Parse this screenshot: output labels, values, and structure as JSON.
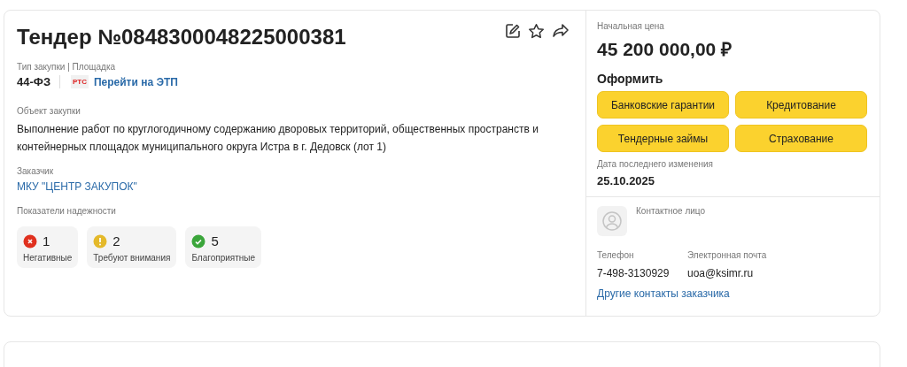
{
  "tender": {
    "title": "Тендер №0848300048225000381",
    "type_label": "Тип закупки | Площадка",
    "law": "44-ФЗ",
    "platform_logo": "РТС",
    "platform_link": "Перейти на ЭТП",
    "object_label": "Объект закупки",
    "object_text": "Выполнение работ по круглогодичному содержанию дворовых территорий, общественных пространств и контейнерных площадок муниципального округа Истра в г. Дедовск (лот 1)",
    "customer_label": "Заказчик",
    "customer": "МКУ \"ЦЕНТР ЗАКУПОК\"",
    "reliability_label": "Показатели надежности",
    "indicators": [
      {
        "kind": "negative",
        "count": "1",
        "label": "Негативные"
      },
      {
        "kind": "warning",
        "count": "2",
        "label": "Требуют внимания"
      },
      {
        "kind": "positive",
        "count": "5",
        "label": "Благоприятные"
      }
    ]
  },
  "price": {
    "label": "Начальная цена",
    "value": "45 200 000,00 ₽",
    "apply_label": "Оформить",
    "buttons": [
      "Банковские гарантии",
      "Кредитование",
      "Тендерные займы",
      "Страхование"
    ],
    "date_label": "Дата последнего изменения",
    "date": "25.10.2025"
  },
  "contact": {
    "person_label": "Контактное лицо",
    "phone_label": "Телефон",
    "phone": "7-498-3130929",
    "email_label": "Электронная почта",
    "email": "uoa@ksimr.ru",
    "other_link": "Другие контакты заказчика"
  }
}
